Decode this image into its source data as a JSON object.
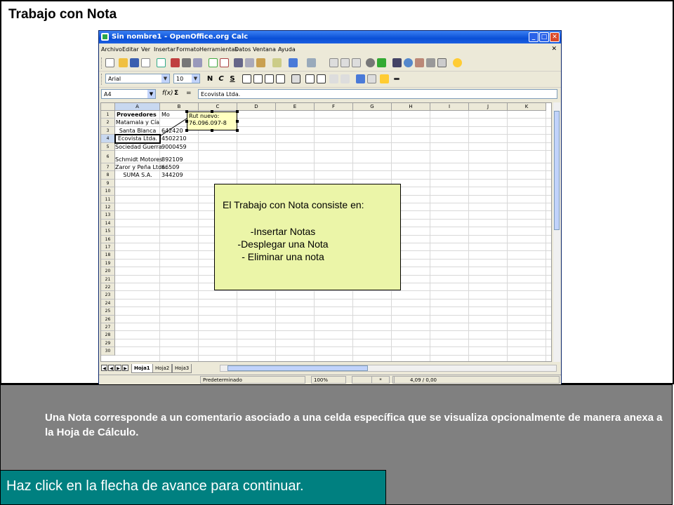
{
  "slide": {
    "title": "Trabajo con Nota",
    "description": "Una Nota corresponde a un comentario asociado a una celda específica que se visualiza opcionalmente de manera anexa a la Hoja de Cálculo.",
    "advance_text": "Haz click en la flecha de avance para continuar."
  },
  "window": {
    "title": "Sin nombre1 - OpenOffice.org Calc",
    "menus": [
      "Archivo",
      "Editar",
      "Ver",
      "Insertar",
      "Formato",
      "Herramientas",
      "Datos",
      "Ventana",
      "Ayuda"
    ],
    "font_name": "Arial",
    "font_size": "10",
    "bold": "N",
    "italic": "C",
    "underline": "S",
    "name_box": "A4",
    "fx_symbol": "f(x)",
    "sum_symbol": "Σ",
    "equals_symbol": "=",
    "formula_value": "Ecovista Ltda."
  },
  "sheet": {
    "columns": [
      "A",
      "B",
      "C",
      "D",
      "E",
      "F",
      "G",
      "H",
      "I",
      "J",
      "K"
    ],
    "rows": [
      "1",
      "2",
      "3",
      "4",
      "5",
      "6",
      "7",
      "8",
      "9",
      "10",
      "11",
      "12",
      "13",
      "14",
      "15",
      "16",
      "17",
      "18",
      "19",
      "20",
      "21",
      "22",
      "23",
      "24",
      "25",
      "26",
      "27",
      "28",
      "29",
      "30"
    ],
    "header_a": "Proveedores",
    "header_b": "Mo",
    "proveedores": [
      "Matamala y Cía",
      "Santa Blanca",
      "Ecovista Ltda.",
      "Sociedad Guerra",
      "Schmidt Motores",
      "Zaror y Peña Ltda.",
      "SUMA S.A."
    ],
    "montos": [
      "",
      "642420",
      "4502210",
      "9000459",
      "892109",
      "66509",
      "344209"
    ],
    "note_text": [
      "Rut nuevo:",
      "76.096.097-8"
    ]
  },
  "tabs": [
    "Hoja1",
    "Hoja2",
    "Hoja3"
  ],
  "status": {
    "style": "Predeterminado",
    "zoom": "100%",
    "mode": "*",
    "position": "4,09 / 0,00"
  },
  "callout": {
    "intro": "El Trabajo con Nota consiste en:",
    "items": [
      "-Insertar Notas",
      "-Desplegar una Nota",
      "- Eliminar una nota"
    ]
  }
}
